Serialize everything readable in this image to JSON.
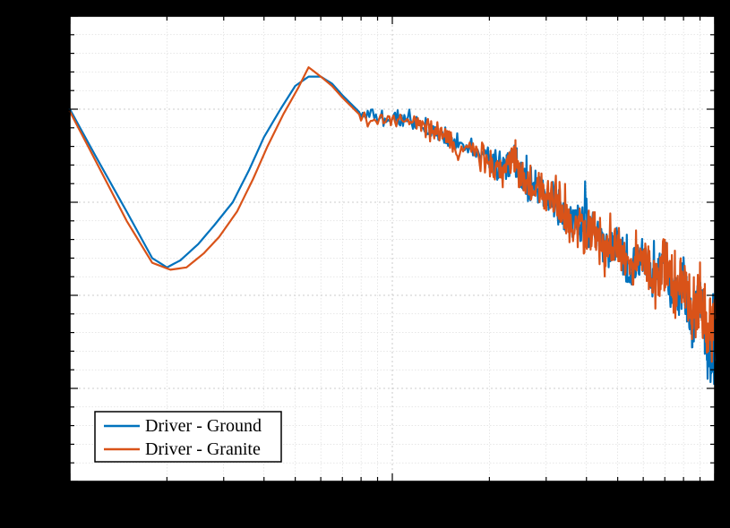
{
  "chart_data": {
    "type": "line",
    "title": "",
    "xlabel": "",
    "ylabel": "",
    "x_scale": "log",
    "xlim": [
      100,
      10000
    ],
    "series": [
      {
        "name": "Driver - Ground",
        "color": "#0072BD",
        "points": [
          [
            100,
            0.8
          ],
          [
            120,
            0.7
          ],
          [
            150,
            0.58
          ],
          [
            180,
            0.48
          ],
          [
            200,
            0.46
          ],
          [
            220,
            0.475
          ],
          [
            250,
            0.51
          ],
          [
            280,
            0.55
          ],
          [
            320,
            0.6
          ],
          [
            360,
            0.67
          ],
          [
            400,
            0.74
          ],
          [
            450,
            0.8
          ],
          [
            500,
            0.85
          ],
          [
            550,
            0.87
          ],
          [
            600,
            0.87
          ],
          [
            650,
            0.855
          ],
          [
            700,
            0.83
          ],
          [
            800,
            0.79
          ],
          [
            900,
            0.78
          ],
          [
            1000,
            0.78
          ],
          [
            1100,
            0.775
          ],
          [
            1200,
            0.77
          ],
          [
            1300,
            0.76
          ],
          [
            1400,
            0.745
          ],
          [
            1500,
            0.73
          ],
          [
            1600,
            0.72
          ],
          [
            1800,
            0.71
          ],
          [
            2000,
            0.69
          ],
          [
            2200,
            0.67
          ],
          [
            2400,
            0.695
          ],
          [
            2500,
            0.65
          ],
          [
            2700,
            0.64
          ],
          [
            3000,
            0.62
          ],
          [
            3300,
            0.59
          ],
          [
            3600,
            0.56
          ],
          [
            4000,
            0.54
          ],
          [
            4300,
            0.53
          ],
          [
            4600,
            0.5
          ],
          [
            5000,
            0.51
          ],
          [
            5500,
            0.45
          ],
          [
            6000,
            0.48
          ],
          [
            6500,
            0.42
          ],
          [
            7000,
            0.47
          ],
          [
            7500,
            0.39
          ],
          [
            8000,
            0.44
          ],
          [
            8500,
            0.33
          ],
          [
            9000,
            0.4
          ],
          [
            9500,
            0.28
          ],
          [
            10000,
            0.26
          ]
        ],
        "noise_from_x": 800,
        "noise_amp": 0.04
      },
      {
        "name": "Driver - Granite",
        "color": "#D95319",
        "points": [
          [
            100,
            0.795
          ],
          [
            120,
            0.69
          ],
          [
            150,
            0.56
          ],
          [
            180,
            0.47
          ],
          [
            205,
            0.455
          ],
          [
            230,
            0.46
          ],
          [
            260,
            0.49
          ],
          [
            290,
            0.525
          ],
          [
            330,
            0.58
          ],
          [
            370,
            0.65
          ],
          [
            410,
            0.72
          ],
          [
            460,
            0.79
          ],
          [
            510,
            0.845
          ],
          [
            550,
            0.89
          ],
          [
            600,
            0.87
          ],
          [
            650,
            0.85
          ],
          [
            700,
            0.825
          ],
          [
            800,
            0.785
          ],
          [
            900,
            0.775
          ],
          [
            1000,
            0.775
          ],
          [
            1100,
            0.77
          ],
          [
            1200,
            0.765
          ],
          [
            1300,
            0.755
          ],
          [
            1400,
            0.74
          ],
          [
            1500,
            0.725
          ],
          [
            1600,
            0.715
          ],
          [
            1800,
            0.705
          ],
          [
            2000,
            0.685
          ],
          [
            2200,
            0.665
          ],
          [
            2400,
            0.7
          ],
          [
            2500,
            0.645
          ],
          [
            2700,
            0.635
          ],
          [
            3000,
            0.615
          ],
          [
            3300,
            0.585
          ],
          [
            3600,
            0.555
          ],
          [
            4000,
            0.535
          ],
          [
            4300,
            0.525
          ],
          [
            4600,
            0.495
          ],
          [
            5000,
            0.505
          ],
          [
            5500,
            0.46
          ],
          [
            6000,
            0.49
          ],
          [
            6500,
            0.43
          ],
          [
            7000,
            0.48
          ],
          [
            7500,
            0.4
          ],
          [
            8000,
            0.45
          ],
          [
            8500,
            0.34
          ],
          [
            9000,
            0.41
          ],
          [
            9500,
            0.3
          ],
          [
            10000,
            0.35
          ]
        ],
        "noise_from_x": 800,
        "noise_amp": 0.045
      }
    ],
    "legend": {
      "position": "lower-left",
      "entries": [
        "Driver - Ground",
        "Driver - Granite"
      ]
    },
    "grid": true
  },
  "legend_labels": {
    "s0": "Driver - Ground",
    "s1": "Driver - Granite"
  }
}
